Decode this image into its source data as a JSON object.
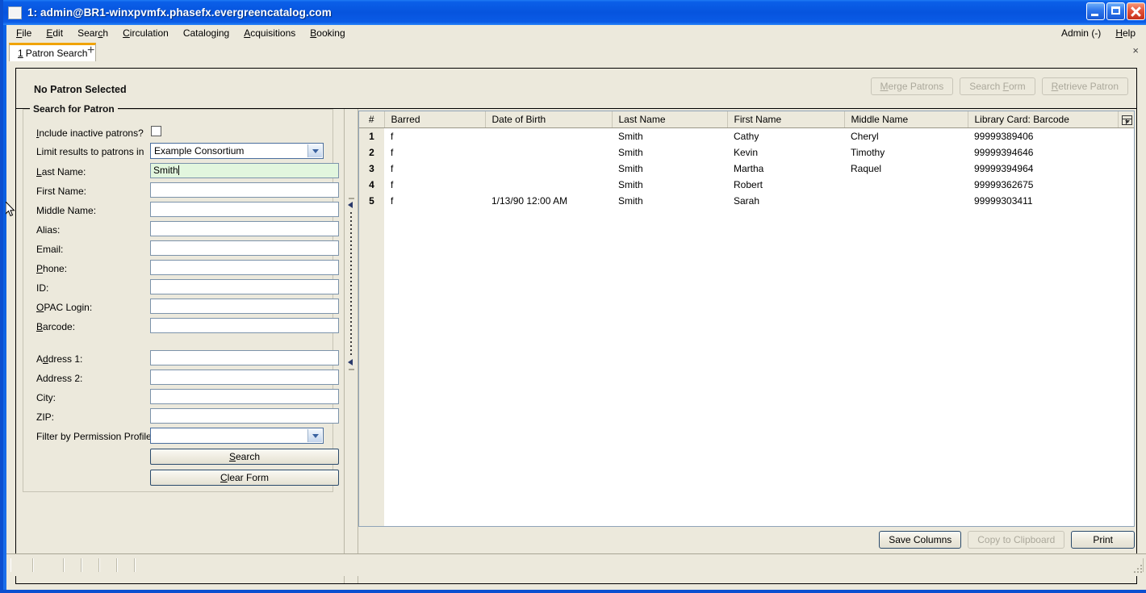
{
  "window": {
    "title": "1: admin@BR1-winxpvmfx.phasefx.evergreencatalog.com",
    "minimize_label": "Minimize",
    "maximize_label": "Maximize",
    "close_label": "Close"
  },
  "menubar": {
    "items": [
      {
        "label": "File",
        "accel": "F"
      },
      {
        "label": "Edit",
        "accel": "E"
      },
      {
        "label": "Search",
        "accel": "c"
      },
      {
        "label": "Circulation",
        "accel": "C"
      },
      {
        "label": "Cataloging",
        "accel": "g"
      },
      {
        "label": "Acquisitions",
        "accel": "A"
      },
      {
        "label": "Booking",
        "accel": "B"
      }
    ],
    "right_items": [
      {
        "label": "Admin (-)",
        "accel": ""
      },
      {
        "label": "Help",
        "accel": "H"
      }
    ]
  },
  "tabs": {
    "active": {
      "index_label": "1",
      "label": "Patron Search"
    },
    "add_label": "+",
    "close_label": "×"
  },
  "patron_header": {
    "status": "No Patron Selected",
    "buttons": [
      {
        "label": "Merge Patrons",
        "enabled": false
      },
      {
        "label": "Search Form",
        "enabled": false
      },
      {
        "label": "Retrieve Patron",
        "enabled": false
      }
    ]
  },
  "search_form": {
    "group_title": "Search for Patron",
    "fields": [
      {
        "label": "Include inactive patrons?",
        "type": "checkbox",
        "checked": false,
        "value": ""
      },
      {
        "label": "Limit results to patrons in",
        "type": "combo",
        "value": "Example Consortium"
      },
      {
        "label": "Last Name:",
        "type": "text",
        "value": "Smith",
        "focused": true
      },
      {
        "label": "First Name:",
        "type": "text",
        "value": ""
      },
      {
        "label": "Middle Name:",
        "type": "text",
        "value": ""
      },
      {
        "label": "Alias:",
        "type": "text",
        "value": ""
      },
      {
        "label": "Email:",
        "type": "text",
        "value": ""
      },
      {
        "label": "Phone:",
        "type": "text",
        "value": ""
      },
      {
        "label": "ID:",
        "type": "text",
        "value": ""
      },
      {
        "label": "OPAC Login:",
        "type": "text",
        "value": ""
      },
      {
        "label": "Barcode:",
        "type": "text",
        "value": ""
      },
      {
        "label": "Address 1:",
        "type": "text",
        "value": ""
      },
      {
        "label": "Address 2:",
        "type": "text",
        "value": ""
      },
      {
        "label": "City:",
        "type": "text",
        "value": ""
      },
      {
        "label": "ZIP:",
        "type": "text",
        "value": ""
      },
      {
        "label": "Filter by Permission Profile:",
        "type": "combo",
        "value": ""
      }
    ],
    "search_button": "Search",
    "clear_button": "Clear Form"
  },
  "results": {
    "columns": [
      "#",
      "Barred",
      "Date of Birth",
      "Last Name",
      "First Name",
      "Middle Name",
      "Library Card: Barcode"
    ],
    "column_picker_label": "Column picker",
    "rows": [
      {
        "num": "1",
        "barred": "f",
        "dob": "",
        "last": "Smith",
        "first": "Cathy",
        "middle": "Cheryl",
        "barcode": "99999389406"
      },
      {
        "num": "2",
        "barred": "f",
        "dob": "",
        "last": "Smith",
        "first": "Kevin",
        "middle": "Timothy",
        "barcode": "99999394646"
      },
      {
        "num": "3",
        "barred": "f",
        "dob": "",
        "last": "Smith",
        "first": "Martha",
        "middle": "Raquel",
        "barcode": "99999394964"
      },
      {
        "num": "4",
        "barred": "f",
        "dob": "",
        "last": "Smith",
        "first": "Robert",
        "middle": "",
        "barcode": "99999362675"
      },
      {
        "num": "5",
        "barred": "f",
        "dob": "1/13/90 12:00 AM",
        "last": "Smith",
        "first": "Sarah",
        "middle": "",
        "barcode": "99999303411"
      }
    ],
    "buttons": [
      {
        "label": "Save Columns",
        "enabled": true
      },
      {
        "label": "Copy to Clipboard",
        "enabled": false
      },
      {
        "label": "Print",
        "enabled": true
      }
    ]
  },
  "statusbar": {
    "cells": [
      "",
      "",
      "",
      "",
      "",
      "",
      ""
    ]
  },
  "colors": {
    "titlebar_blue": "#0654DE",
    "chrome_beige": "#ECE9DC",
    "active_tab_accent": "#F0A300",
    "focused_field_green": "#E2F6DE",
    "default_button_border": "#2A4A6B"
  }
}
